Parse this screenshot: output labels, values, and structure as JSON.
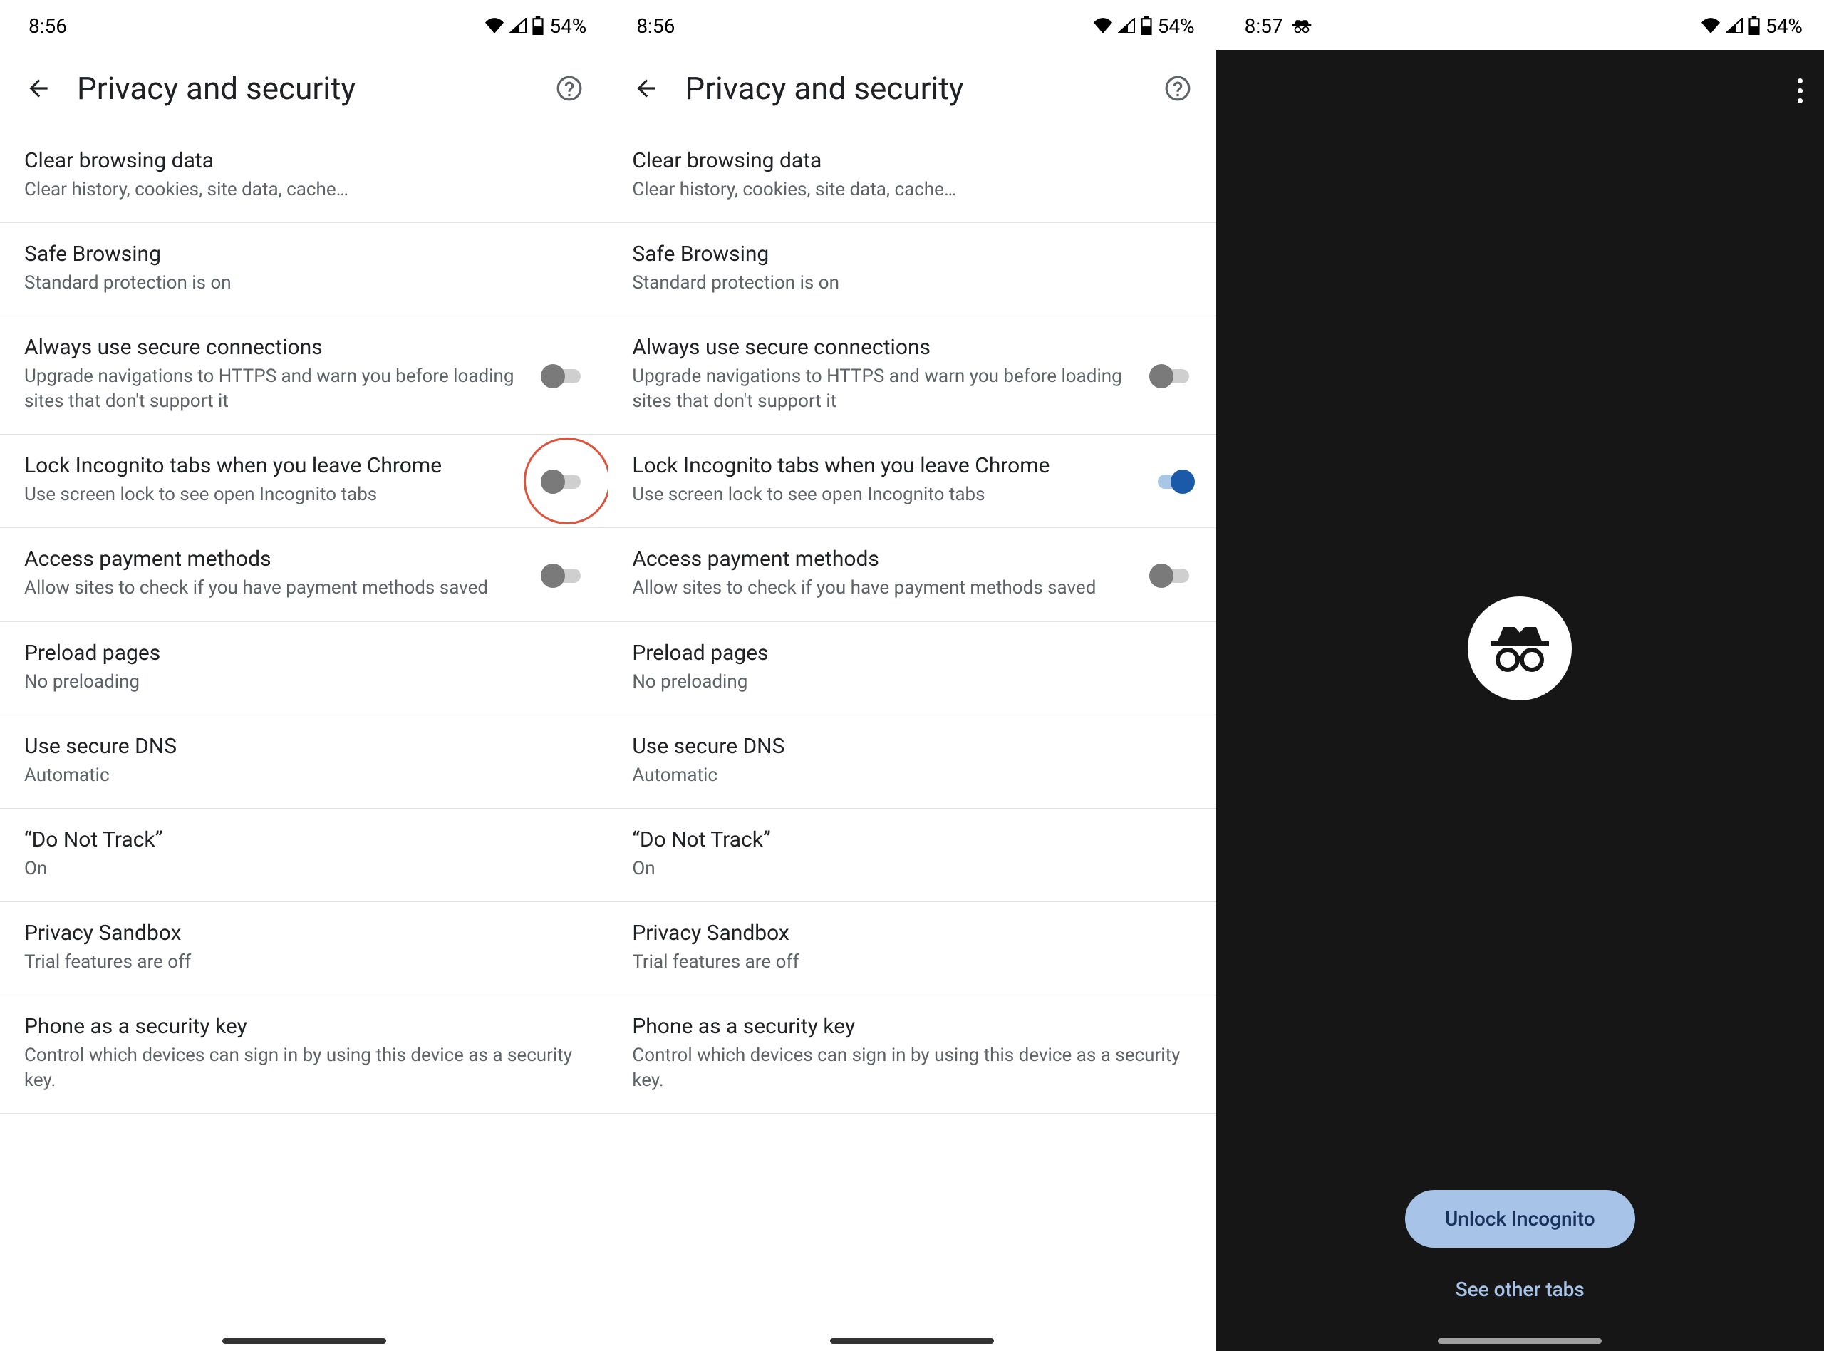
{
  "panels": [
    {
      "statusbar": {
        "time": "8:56",
        "battery": "54%",
        "showIncognito": false
      },
      "appbar": {
        "title": "Privacy and security"
      },
      "rows": [
        {
          "title": "Clear browsing data",
          "sub": "Clear history, cookies, site data, cache…",
          "toggle": null
        },
        {
          "title": "Safe Browsing",
          "sub": "Standard protection is on",
          "toggle": null
        },
        {
          "title": "Always use secure connections",
          "sub": "Upgrade navigations to HTTPS and warn you before loading sites that don't support it",
          "toggle": "off"
        },
        {
          "title": "Lock Incognito tabs when you leave Chrome",
          "sub": "Use screen lock to see open Incognito tabs",
          "toggle": "off",
          "highlight": true
        },
        {
          "title": "Access payment methods",
          "sub": "Allow sites to check if you have payment methods saved",
          "toggle": "off"
        },
        {
          "title": "Preload pages",
          "sub": "No preloading",
          "toggle": null
        },
        {
          "title": "Use secure DNS",
          "sub": "Automatic",
          "toggle": null
        },
        {
          "title": "“Do Not Track”",
          "sub": "On",
          "toggle": null
        },
        {
          "title": "Privacy Sandbox",
          "sub": "Trial features are off",
          "toggle": null
        },
        {
          "title": "Phone as a security key",
          "sub": "Control which devices can sign in by using this device as a security key.",
          "toggle": null
        }
      ]
    },
    {
      "statusbar": {
        "time": "8:56",
        "battery": "54%",
        "showIncognito": false
      },
      "appbar": {
        "title": "Privacy and security"
      },
      "rows": [
        {
          "title": "Clear browsing data",
          "sub": "Clear history, cookies, site data, cache…",
          "toggle": null
        },
        {
          "title": "Safe Browsing",
          "sub": "Standard protection is on",
          "toggle": null
        },
        {
          "title": "Always use secure connections",
          "sub": "Upgrade navigations to HTTPS and warn you before loading sites that don't support it",
          "toggle": "off"
        },
        {
          "title": "Lock Incognito tabs when you leave Chrome",
          "sub": "Use screen lock to see open Incognito tabs",
          "toggle": "on"
        },
        {
          "title": "Access payment methods",
          "sub": "Allow sites to check if you have payment methods saved",
          "toggle": "off"
        },
        {
          "title": "Preload pages",
          "sub": "No preloading",
          "toggle": null
        },
        {
          "title": "Use secure DNS",
          "sub": "Automatic",
          "toggle": null
        },
        {
          "title": "“Do Not Track”",
          "sub": "On",
          "toggle": null
        },
        {
          "title": "Privacy Sandbox",
          "sub": "Trial features are off",
          "toggle": null
        },
        {
          "title": "Phone as a security key",
          "sub": "Control which devices can sign in by using this device as a security key.",
          "toggle": null
        }
      ]
    }
  ],
  "incognito": {
    "statusbar": {
      "time": "8:57",
      "battery": "54%",
      "showIncognito": true
    },
    "unlock_label": "Unlock Incognito",
    "other_tabs_label": "See other tabs"
  },
  "icons": {
    "wifi": "▲",
    "signal": "◢",
    "battery": "▮"
  }
}
